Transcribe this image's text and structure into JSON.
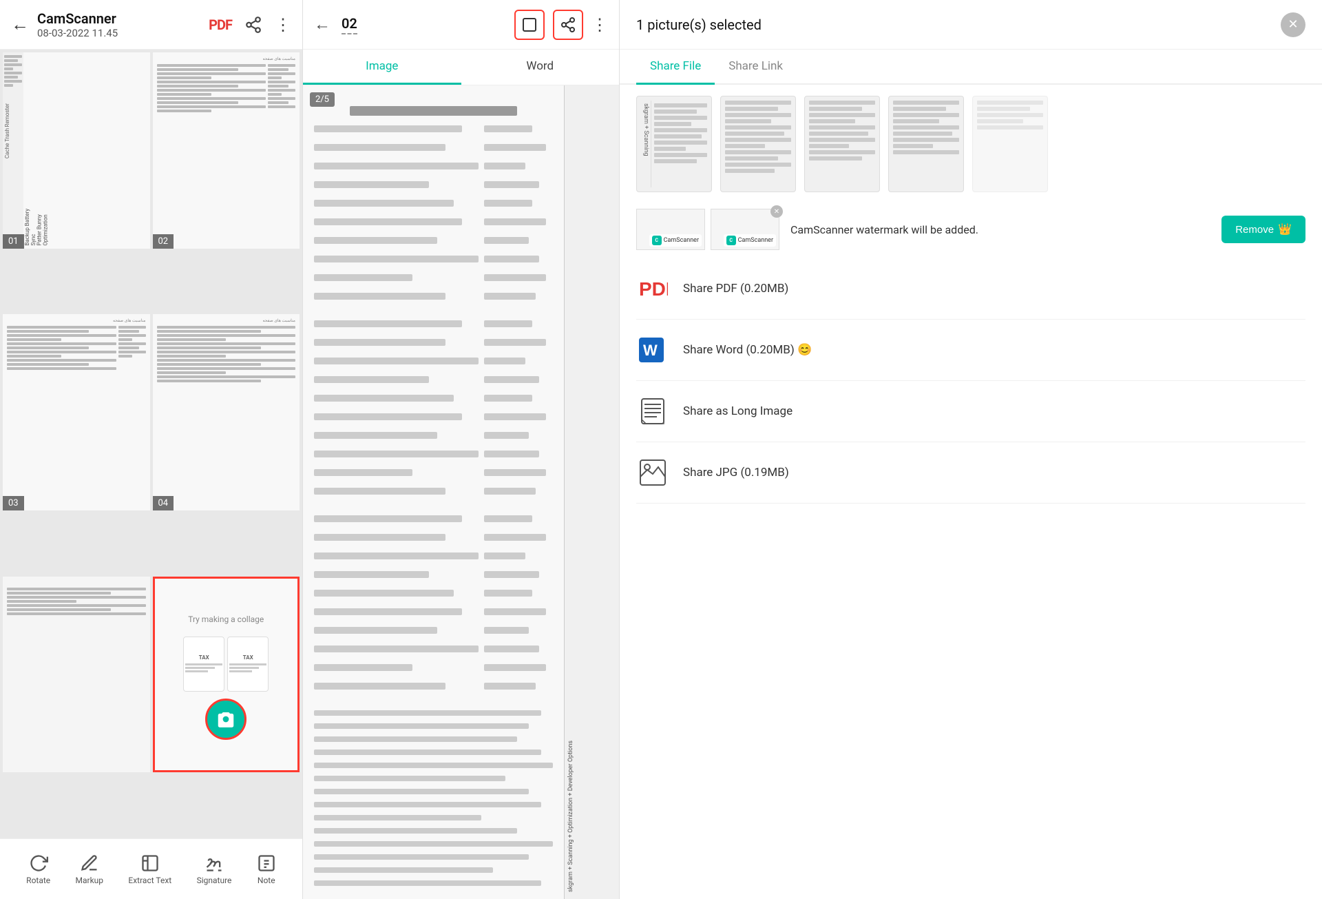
{
  "app": {
    "name": "CamScanner",
    "date": "08-03-2022 11.45"
  },
  "left_panel": {
    "thumbnails": [
      {
        "label": "01"
      },
      {
        "label": "02"
      },
      {
        "label": "03"
      },
      {
        "label": "04"
      }
    ],
    "collage_text": "Try making a collage"
  },
  "middle_panel": {
    "page_num": "02",
    "tab_image": "Image",
    "tab_word": "Word",
    "page_badge": "2/5"
  },
  "right_panel": {
    "selected_count": "1 picture(s) selected",
    "tab_share_file": "Share File",
    "tab_share_link": "Share Link",
    "watermark_text": "CamScanner watermark will be added.",
    "remove_label": "Remove",
    "share_options": [
      {
        "label": "Share PDF  (0.20MB)",
        "icon": "pdf"
      },
      {
        "label": "Share Word  (0.20MB)",
        "icon": "word",
        "emoji": "😊"
      },
      {
        "label": "Share as Long Image",
        "icon": "long-image"
      },
      {
        "label": "Share JPG  (0.19MB)",
        "icon": "jpg"
      }
    ]
  },
  "bottom_toolbar": {
    "items": [
      {
        "label": "Rotate",
        "icon": "rotate"
      },
      {
        "label": "Markup",
        "icon": "markup"
      },
      {
        "label": "Extract Text",
        "icon": "ocr"
      },
      {
        "label": "Signature",
        "icon": "signature"
      },
      {
        "label": "Note",
        "icon": "note"
      }
    ]
  },
  "icons": {
    "back": "←",
    "more": "⋮",
    "pdf": "PDF",
    "share": "⤴",
    "crop": "⬜",
    "close": "✕",
    "camera": "📷",
    "rotate": "↻",
    "markup": "✏",
    "ocr": "T",
    "signature": "✍",
    "note": "📋"
  }
}
